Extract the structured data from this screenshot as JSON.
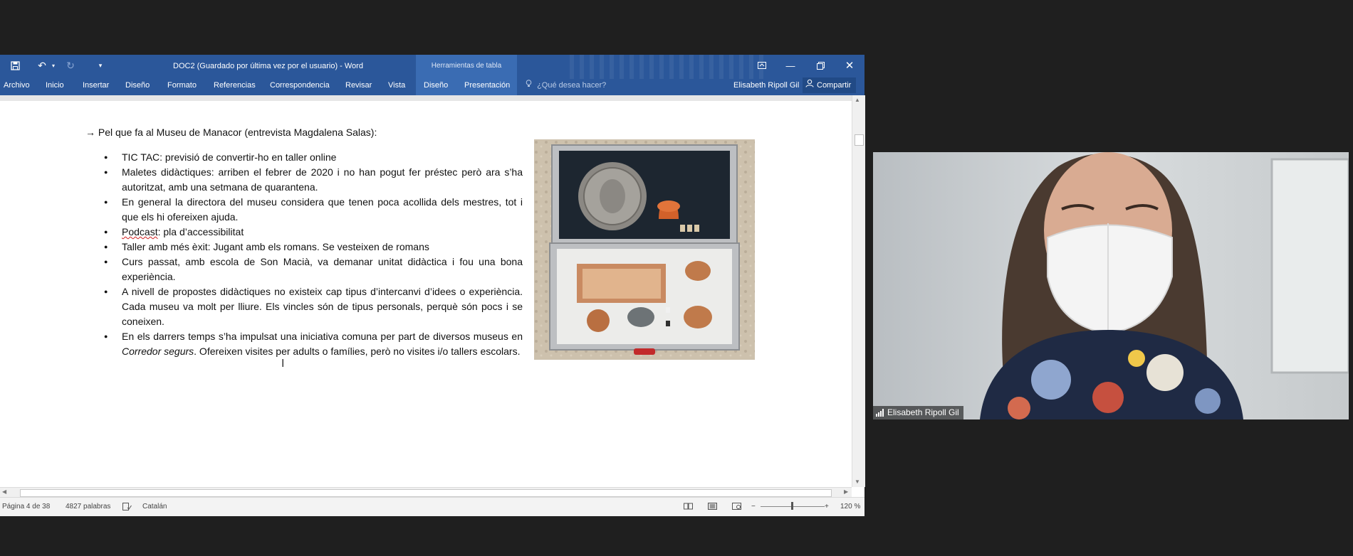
{
  "word": {
    "title": "DOC2 (Guardado por última vez por el usuario) - Word",
    "context_group": "Herramientas de tabla",
    "tabs": [
      "Archivo",
      "Inicio",
      "Insertar",
      "Diseño",
      "Formato",
      "Referencias",
      "Correspondencia",
      "Revisar",
      "Vista"
    ],
    "context_tabs": [
      "Diseño",
      "Presentación"
    ],
    "tell_me": "¿Qué desea hacer?",
    "user": "Elisabeth Ripoll Gil",
    "share": "Compartir",
    "status": {
      "page": "Página 4 de 38",
      "words": "4827 palabras",
      "language": "Catalán",
      "zoom": "120 %"
    }
  },
  "document": {
    "heading": "Pel que fa al Museu de Manacor (entrevista Magdalena Salas):",
    "bullets": [
      "TIC TAC: previsió de convertir-ho en taller online",
      "Maletes didàctiques: arriben el febrer de 2020 i no han pogut fer préstec però ara s’ha autoritzat, amb una setmana de quarantena.",
      "En general la directora del museu considera que tenen poca acollida dels mestres, tot i que els hi ofereixen ajuda.",
      "Podcast: pla d’accessibilitat",
      "Taller amb més èxit: Jugant amb els romans. Se vesteixen de romans",
      "Curs passat, amb escola de Son Macià, va demanar unitat didàctica i fou una bona experiència.",
      "A nivell de propostes didàctiques no existeix cap tipus d’intercanvi d’idees o experiència. Cada museu va molt per lliure. Els vincles són de tipus personals,  perquè són pocs i se coneixen."
    ],
    "last_bullet": {
      "before": "En els darrers temps s’ha impulsat una iniciativa comuna per part de diversos museus en ",
      "italic": "Corredor segurs",
      "after": ". Ofereixen visites per adults o famílies, però no visites i/o tallers escolars."
    }
  },
  "video": {
    "participant": "Elisabeth Ripoll Gil"
  },
  "colors": {
    "word_blue": "#2b579a",
    "context_tab": "#3a6cb3",
    "share_bg": "#214a86"
  }
}
